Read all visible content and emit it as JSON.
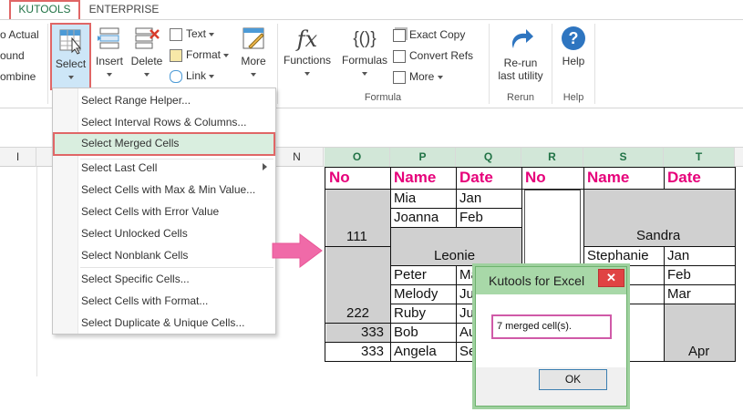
{
  "tabs": {
    "kutools": "KUTOOLS",
    "enterprise": "ENTERPRISE"
  },
  "ribbon": {
    "left_items": [
      "o Actual",
      "ound",
      "ombine"
    ],
    "select": "Select",
    "insert": "Insert",
    "delete": "Delete",
    "text": "Text",
    "format": "Format",
    "link": "Link",
    "more": "More",
    "functions": "Functions",
    "formulas": "Formulas",
    "exact_copy": "Exact Copy",
    "convert_refs": "Convert Refs",
    "more2": "More",
    "rerun_line1": "Re-run",
    "rerun_line2": "last utility",
    "help": "Help",
    "groups": {
      "formula": "Formula",
      "rerun": "Rerun",
      "help": "Help"
    }
  },
  "menu": {
    "items": [
      "Select Range Helper...",
      "Select Interval Rows & Columns...",
      "Select Merged Cells",
      "Select Last Cell",
      "Select Cells with Max & Min Value...",
      "Select Cells with Error Value",
      "Select Unlocked Cells",
      "Select Nonblank Cells",
      "Select Specific Cells...",
      "Select Cells with Format...",
      "Select Duplicate & Unique Cells..."
    ],
    "highlighted_index": 2
  },
  "columns": [
    "I",
    "N",
    "O",
    "P",
    "Q",
    "R",
    "S",
    "T"
  ],
  "sheet": {
    "headers": [
      "No",
      "Name",
      "Date",
      "No",
      "Name",
      "Date"
    ],
    "left_table": {
      "no": [
        "111",
        "222",
        "333",
        "333"
      ],
      "names": [
        "Mia",
        "Joanna",
        "Leonie",
        "Peter",
        "Melody",
        "Ruby",
        "Bob",
        "Angela"
      ],
      "dates": [
        "Jan",
        "Feb",
        "Ma",
        "Ju",
        "Ju",
        "Au",
        "Se"
      ]
    },
    "right_table": {
      "names": [
        "Sandra",
        "Stephanie"
      ],
      "dates": [
        "Jan",
        "Feb",
        "Mar",
        "Apr"
      ]
    }
  },
  "dialog": {
    "title": "Kutools for Excel",
    "close": "✕",
    "message": "7 merged cell(s).",
    "ok": "OK"
  },
  "colors": {
    "accent": "#217346",
    "highlight_border": "#e06666",
    "header_text": "#e6007a",
    "arrow": "#f06aa8"
  }
}
